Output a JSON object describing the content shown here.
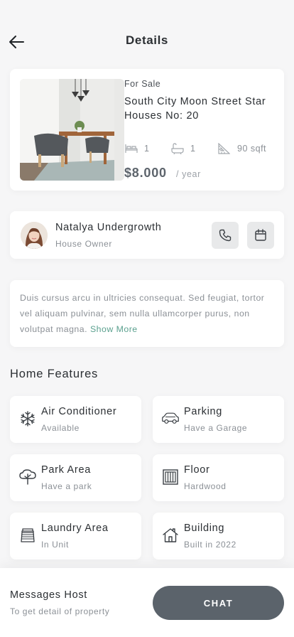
{
  "header": {
    "title": "Details"
  },
  "property": {
    "status": "For Sale",
    "name": "South City Moon Street Star Houses No: 20",
    "specs": [
      {
        "icon": "bed-icon",
        "value": "1"
      },
      {
        "icon": "bathtub-icon",
        "value": "1"
      },
      {
        "icon": "area-ruler-icon",
        "value": "90 sqft"
      }
    ],
    "price": "$8.000",
    "price_unit": "/ year"
  },
  "owner": {
    "name": "Natalya Undergrowth",
    "role": "House Owner"
  },
  "description": {
    "text": "Duis cursus arcu in ultricies consequat. Sed feugiat, tortor vel aliquam pulvinar, sem nulla ullamcorper purus, non volutpat magna.",
    "show_more": "Show More"
  },
  "features": {
    "title": "Home Features",
    "items": [
      {
        "icon": "snowflake-icon",
        "name": "Air Conditioner",
        "sub": "Available"
      },
      {
        "icon": "car-icon",
        "name": "Parking",
        "sub": "Have a Garage"
      },
      {
        "icon": "tree-icon",
        "name": "Park Area",
        "sub": "Have a park"
      },
      {
        "icon": "floor-icon",
        "name": "Floor",
        "sub": "Hardwood"
      },
      {
        "icon": "laundry-icon",
        "name": "Laundry Area",
        "sub": "In Unit"
      },
      {
        "icon": "house-icon",
        "name": "Building",
        "sub": "Built in 2022"
      }
    ]
  },
  "bottom": {
    "title": "Messages Host",
    "subtitle": "To get detail of property",
    "chat_label": "CHAT"
  },
  "colors": {
    "background": "#f6f6f7",
    "card": "#ffffff",
    "accent_link": "#5aa08e",
    "button": "#5b636b"
  }
}
